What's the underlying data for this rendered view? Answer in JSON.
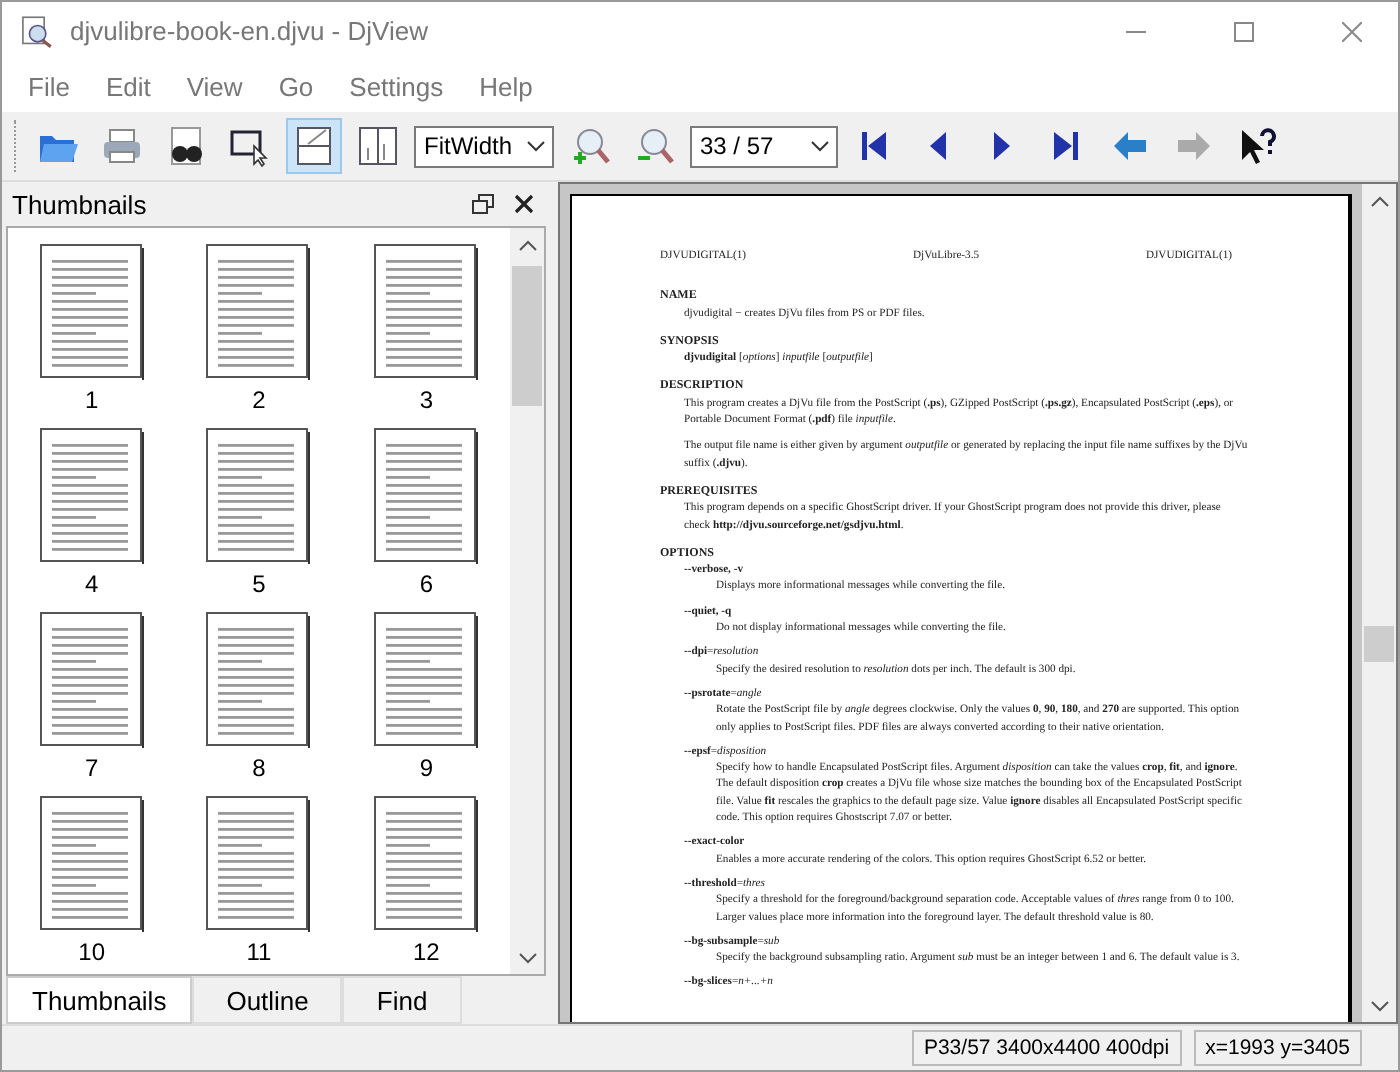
{
  "window": {
    "title": "djvulibre-book-en.djvu - DjView"
  },
  "menu": [
    "File",
    "Edit",
    "View",
    "Go",
    "Settings",
    "Help"
  ],
  "toolbar": {
    "layout_buttons": [
      {
        "selected": true
      },
      {
        "selected": false
      }
    ],
    "zoom": "FitWidth",
    "page": "33 / 57",
    "history": [
      {
        "disabled": false
      },
      {
        "disabled": true
      }
    ]
  },
  "sidebar": {
    "title": "Thumbnails",
    "thumbnails": [
      {
        "label": "1"
      },
      {
        "label": "2"
      },
      {
        "label": "3"
      },
      {
        "label": "4"
      },
      {
        "label": "5"
      },
      {
        "label": "6"
      },
      {
        "label": "7"
      },
      {
        "label": "8"
      },
      {
        "label": "9"
      },
      {
        "label": "10"
      },
      {
        "label": "11"
      },
      {
        "label": "12"
      }
    ],
    "tabs": [
      {
        "label": "Thumbnails",
        "selected": true
      },
      {
        "label": "Outline",
        "selected": false
      },
      {
        "label": "Find",
        "selected": false
      }
    ]
  },
  "document": {
    "header": [
      "DJVUDIGITAL(1)",
      "DjVuLibre-3.5",
      "DJVUDIGITAL(1)"
    ],
    "sections": [
      {
        "heading": "NAME",
        "blocks": [
          {
            "kind": "para",
            "text": "djvudigital − creates DjVu files from PS or PDF files."
          }
        ]
      },
      {
        "heading": "SYNOPSIS",
        "blocks": [
          {
            "kind": "para",
            "text": "**djvudigital**  [*options*] *inputfile* [*outputfile*]"
          }
        ]
      },
      {
        "heading": "DESCRIPTION",
        "blocks": [
          {
            "kind": "para",
            "text": "This program creates a DjVu file from the PostScript (**.ps**), GZipped PostScript (**.ps.gz**), Encapsulated PostScript (**.eps**), or Portable Document Format (**.pdf**) file *inputfile*."
          },
          {
            "kind": "para",
            "text": "The output file name is either given by argument *outputfile* or generated by replacing the input file name suffixes by the DjVu suffix (**.djvu**)."
          }
        ]
      },
      {
        "heading": "PREREQUISITES",
        "blocks": [
          {
            "kind": "para",
            "text": "This program depends on a specific GhostScript driver.  If your GhostScript program does not provide this driver, please check **http://djvu.sourceforge.net/gsdjvu.html**."
          }
        ]
      },
      {
        "heading": "OPTIONS",
        "blocks": [
          {
            "kind": "option",
            "term": "**--verbose, -v**",
            "text": "Displays more informational messages while converting the file."
          },
          {
            "kind": "option",
            "term": "**--quiet, -q**",
            "text": "Do not display informational messages while converting the file."
          },
          {
            "kind": "option",
            "term": "**--dpi**=*resolution*",
            "text": "Specify the desired resolution to *resolution* dots per inch.  The default is 300 dpi."
          },
          {
            "kind": "option",
            "term": "**--psrotate**=*angle*",
            "text": "Rotate the PostScript file by *angle* degrees clockwise.  Only the values **0**, **90**, **180**, and **270** are supported.  This option only applies to PostScript files.  PDF files are always converted according to their native orientation."
          },
          {
            "kind": "option",
            "term": "**--epsf**=*disposition*",
            "text": "Specify how to handle Encapsulated PostScript files.  Argument *disposition* can take the values **crop**, **fit**, and **ignore**.  The default disposition **crop** creates a DjVu file whose size matches the bounding box of the Encapsulated PostScript file.  Value **fit** rescales the graphics to the default page size.  Value **ignore** disables all Encapsulated PostScript specific code.  This option requires Ghostscript 7.07 or better."
          },
          {
            "kind": "option",
            "term": "**--exact-color**",
            "text": "Enables a more accurate rendering of the colors.  This option requires GhostScript 6.52 or better."
          },
          {
            "kind": "option",
            "term": "**--threshold**=*thres*",
            "text": "Specify a threshold for the foreground/background separation code.  Acceptable values of *thres* range from 0 to 100. Larger values place more information into the foreground layer.  The default threshold value is 80."
          },
          {
            "kind": "option",
            "term": "**--bg-subsample**=*sub*",
            "text": "Specify the background subsampling ratio.  Argument *sub* must be an integer between 1 and 6. The default value is 3."
          },
          {
            "kind": "option",
            "term": "**--bg-slices**=*n+...+n*"
          }
        ]
      }
    ]
  },
  "status_bar": [
    "P33/57 3400x4400 400dpi",
    "x=1993 y=3405"
  ]
}
